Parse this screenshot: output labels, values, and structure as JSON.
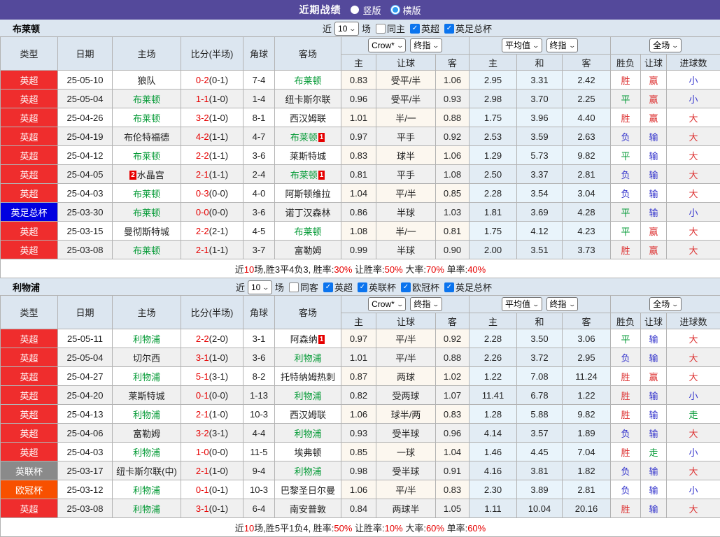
{
  "colors": {
    "accent_bar": "#54499b",
    "header_bg": "#dce6f0",
    "score_red": "#e60000",
    "team_green": "#009933",
    "result_red": "#dd3333",
    "result_green": "#009933",
    "result_blue": "#3333cc",
    "league": {
      "英超": "#ef2d2d",
      "英足总杯": "#0000e0",
      "英联杯": "#8a8a8a",
      "欧冠杯": "#f85000"
    }
  },
  "title_bar": {
    "title": "近期战绩",
    "radios": [
      {
        "label": "竖版",
        "selected": true
      },
      {
        "label": "横版",
        "selected": false
      }
    ]
  },
  "table_header": {
    "static_cols": [
      "类型",
      "日期",
      "主场",
      "比分(半场)",
      "角球",
      "客场"
    ],
    "group1_selects": [
      "Crow*",
      "终指"
    ],
    "group2_selects": [
      "平均值",
      "终指"
    ],
    "group3_selects": [
      "全场"
    ],
    "sub_cols": [
      "主",
      "让球",
      "客",
      "主",
      "和",
      "客",
      "胜负",
      "让球",
      "进球数"
    ]
  },
  "sections": [
    {
      "team": "布莱顿",
      "filter": {
        "near": "近",
        "count": "10",
        "unit": "场",
        "same": {
          "label": "同主",
          "checked": false
        },
        "leagues": [
          {
            "label": "英超",
            "checked": true
          },
          {
            "label": "英足总杯",
            "checked": true
          }
        ]
      },
      "rows": [
        {
          "lg": "英超",
          "date": "25-05-10",
          "home": "狼队",
          "hg": false,
          "hb": "",
          "score": "0-2",
          "half": "(0-1)",
          "corner": "7-4",
          "away": "布莱顿",
          "ag": true,
          "ab": "",
          "o1": "0.83",
          "hd": "受平/半",
          "o2": "1.06",
          "a1": "2.95",
          "a2": "3.31",
          "a3": "2.42",
          "r1": "胜",
          "c1": "r",
          "r2": "赢",
          "c2": "r",
          "r3": "小",
          "c3": "b"
        },
        {
          "lg": "英超",
          "date": "25-05-04",
          "home": "布莱顿",
          "hg": true,
          "hb": "",
          "score": "1-1",
          "half": "(1-0)",
          "corner": "1-4",
          "away": "纽卡斯尔联",
          "ag": false,
          "ab": "",
          "o1": "0.96",
          "hd": "受平/半",
          "o2": "0.93",
          "a1": "2.98",
          "a2": "3.70",
          "a3": "2.25",
          "r1": "平",
          "c1": "g",
          "r2": "赢",
          "c2": "r",
          "r3": "小",
          "c3": "b"
        },
        {
          "lg": "英超",
          "date": "25-04-26",
          "home": "布莱顿",
          "hg": true,
          "hb": "",
          "score": "3-2",
          "half": "(1-0)",
          "corner": "8-1",
          "away": "西汉姆联",
          "ag": false,
          "ab": "",
          "o1": "1.01",
          "hd": "半/一",
          "o2": "0.88",
          "a1": "1.75",
          "a2": "3.96",
          "a3": "4.40",
          "r1": "胜",
          "c1": "r",
          "r2": "赢",
          "c2": "r",
          "r3": "大",
          "c3": "r"
        },
        {
          "lg": "英超",
          "date": "25-04-19",
          "home": "布伦特福德",
          "hg": false,
          "hb": "",
          "score": "4-2",
          "half": "(1-1)",
          "corner": "4-7",
          "away": "布莱顿",
          "ag": true,
          "ab": "1",
          "o1": "0.97",
          "hd": "平手",
          "o2": "0.92",
          "a1": "2.53",
          "a2": "3.59",
          "a3": "2.63",
          "r1": "负",
          "c1": "b",
          "r2": "输",
          "c2": "b",
          "r3": "大",
          "c3": "r"
        },
        {
          "lg": "英超",
          "date": "25-04-12",
          "home": "布莱顿",
          "hg": true,
          "hb": "",
          "score": "2-2",
          "half": "(1-1)",
          "corner": "3-6",
          "away": "莱斯特城",
          "ag": false,
          "ab": "",
          "o1": "0.83",
          "hd": "球半",
          "o2": "1.06",
          "a1": "1.29",
          "a2": "5.73",
          "a3": "9.82",
          "r1": "平",
          "c1": "g",
          "r2": "输",
          "c2": "b",
          "r3": "大",
          "c3": "r"
        },
        {
          "lg": "英超",
          "date": "25-04-05",
          "home": "水晶宫",
          "hg": false,
          "hb": "2",
          "score": "2-1",
          "half": "(1-1)",
          "corner": "2-4",
          "away": "布莱顿",
          "ag": true,
          "ab": "1",
          "o1": "0.81",
          "hd": "平手",
          "o2": "1.08",
          "a1": "2.50",
          "a2": "3.37",
          "a3": "2.81",
          "r1": "负",
          "c1": "b",
          "r2": "输",
          "c2": "b",
          "r3": "大",
          "c3": "r"
        },
        {
          "lg": "英超",
          "date": "25-04-03",
          "home": "布莱顿",
          "hg": true,
          "hb": "",
          "score": "0-3",
          "half": "(0-0)",
          "corner": "4-0",
          "away": "阿斯顿维拉",
          "ag": false,
          "ab": "",
          "o1": "1.04",
          "hd": "平/半",
          "o2": "0.85",
          "a1": "2.28",
          "a2": "3.54",
          "a3": "3.04",
          "r1": "负",
          "c1": "b",
          "r2": "输",
          "c2": "b",
          "r3": "大",
          "c3": "r"
        },
        {
          "lg": "英足总杯",
          "date": "25-03-30",
          "home": "布莱顿",
          "hg": true,
          "hb": "",
          "score": "0-0",
          "half": "(0-0)",
          "corner": "3-6",
          "away": "诺丁汉森林",
          "ag": false,
          "ab": "",
          "o1": "0.86",
          "hd": "半球",
          "o2": "1.03",
          "a1": "1.81",
          "a2": "3.69",
          "a3": "4.28",
          "r1": "平",
          "c1": "g",
          "r2": "输",
          "c2": "b",
          "r3": "小",
          "c3": "b"
        },
        {
          "lg": "英超",
          "date": "25-03-15",
          "home": "曼彻斯特城",
          "hg": false,
          "hb": "",
          "score": "2-2",
          "half": "(2-1)",
          "corner": "4-5",
          "away": "布莱顿",
          "ag": true,
          "ab": "",
          "o1": "1.08",
          "hd": "半/一",
          "o2": "0.81",
          "a1": "1.75",
          "a2": "4.12",
          "a3": "4.23",
          "r1": "平",
          "c1": "g",
          "r2": "赢",
          "c2": "r",
          "r3": "大",
          "c3": "r"
        },
        {
          "lg": "英超",
          "date": "25-03-08",
          "home": "布莱顿",
          "hg": true,
          "hb": "",
          "score": "2-1",
          "half": "(1-1)",
          "corner": "3-7",
          "away": "富勒姆",
          "ag": false,
          "ab": "",
          "o1": "0.99",
          "hd": "半球",
          "o2": "0.90",
          "a1": "2.00",
          "a2": "3.51",
          "a3": "3.73",
          "r1": "胜",
          "c1": "r",
          "r2": "赢",
          "c2": "r",
          "r3": "大",
          "c3": "r"
        }
      ],
      "summary": [
        {
          "t": "近"
        },
        {
          "t": "10",
          "red": true
        },
        {
          "t": "场,胜3平4负3, 胜率:"
        },
        {
          "t": "30%",
          "red": true
        },
        {
          "t": " 让胜率:"
        },
        {
          "t": "50%",
          "red": true
        },
        {
          "t": " 大率:"
        },
        {
          "t": "70%",
          "red": true
        },
        {
          "t": " 单率:"
        },
        {
          "t": "40%",
          "red": true
        }
      ]
    },
    {
      "team": "利物浦",
      "filter": {
        "near": "近",
        "count": "10",
        "unit": "场",
        "same": {
          "label": "同客",
          "checked": false
        },
        "leagues": [
          {
            "label": "英超",
            "checked": true
          },
          {
            "label": "英联杯",
            "checked": true
          },
          {
            "label": "欧冠杯",
            "checked": true
          },
          {
            "label": "英足总杯",
            "checked": true
          }
        ]
      },
      "rows": [
        {
          "lg": "英超",
          "date": "25-05-11",
          "home": "利物浦",
          "hg": true,
          "hb": "",
          "score": "2-2",
          "half": "(2-0)",
          "corner": "3-1",
          "away": "阿森纳",
          "ag": false,
          "ab": "1",
          "o1": "0.97",
          "hd": "平/半",
          "o2": "0.92",
          "a1": "2.28",
          "a2": "3.50",
          "a3": "3.06",
          "r1": "平",
          "c1": "g",
          "r2": "输",
          "c2": "b",
          "r3": "大",
          "c3": "r"
        },
        {
          "lg": "英超",
          "date": "25-05-04",
          "home": "切尔西",
          "hg": false,
          "hb": "",
          "score": "3-1",
          "half": "(1-0)",
          "corner": "3-6",
          "away": "利物浦",
          "ag": true,
          "ab": "",
          "o1": "1.01",
          "hd": "平/半",
          "o2": "0.88",
          "a1": "2.26",
          "a2": "3.72",
          "a3": "2.95",
          "r1": "负",
          "c1": "b",
          "r2": "输",
          "c2": "b",
          "r3": "大",
          "c3": "r"
        },
        {
          "lg": "英超",
          "date": "25-04-27",
          "home": "利物浦",
          "hg": true,
          "hb": "",
          "score": "5-1",
          "half": "(3-1)",
          "corner": "8-2",
          "away": "托特纳姆热刺",
          "ag": false,
          "ab": "",
          "o1": "0.87",
          "hd": "两球",
          "o2": "1.02",
          "a1": "1.22",
          "a2": "7.08",
          "a3": "11.24",
          "r1": "胜",
          "c1": "r",
          "r2": "赢",
          "c2": "r",
          "r3": "大",
          "c3": "r"
        },
        {
          "lg": "英超",
          "date": "25-04-20",
          "home": "莱斯特城",
          "hg": false,
          "hb": "",
          "score": "0-1",
          "half": "(0-0)",
          "corner": "1-13",
          "away": "利物浦",
          "ag": true,
          "ab": "",
          "o1": "0.82",
          "hd": "受两球",
          "o2": "1.07",
          "a1": "11.41",
          "a2": "6.78",
          "a3": "1.22",
          "r1": "胜",
          "c1": "r",
          "r2": "输",
          "c2": "b",
          "r3": "小",
          "c3": "b"
        },
        {
          "lg": "英超",
          "date": "25-04-13",
          "home": "利物浦",
          "hg": true,
          "hb": "",
          "score": "2-1",
          "half": "(1-0)",
          "corner": "10-3",
          "away": "西汉姆联",
          "ag": false,
          "ab": "",
          "o1": "1.06",
          "hd": "球半/两",
          "o2": "0.83",
          "a1": "1.28",
          "a2": "5.88",
          "a3": "9.82",
          "r1": "胜",
          "c1": "r",
          "r2": "输",
          "c2": "b",
          "r3": "走",
          "c3": "g"
        },
        {
          "lg": "英超",
          "date": "25-04-06",
          "home": "富勒姆",
          "hg": false,
          "hb": "",
          "score": "3-2",
          "half": "(3-1)",
          "corner": "4-4",
          "away": "利物浦",
          "ag": true,
          "ab": "",
          "o1": "0.93",
          "hd": "受半球",
          "o2": "0.96",
          "a1": "4.14",
          "a2": "3.57",
          "a3": "1.89",
          "r1": "负",
          "c1": "b",
          "r2": "输",
          "c2": "b",
          "r3": "大",
          "c3": "r"
        },
        {
          "lg": "英超",
          "date": "25-04-03",
          "home": "利物浦",
          "hg": true,
          "hb": "",
          "score": "1-0",
          "half": "(0-0)",
          "corner": "11-5",
          "away": "埃弗顿",
          "ag": false,
          "ab": "",
          "o1": "0.85",
          "hd": "一球",
          "o2": "1.04",
          "a1": "1.46",
          "a2": "4.45",
          "a3": "7.04",
          "r1": "胜",
          "c1": "r",
          "r2": "走",
          "c2": "g",
          "r3": "小",
          "c3": "b"
        },
        {
          "lg": "英联杯",
          "date": "25-03-17",
          "home": "纽卡斯尔联(中)",
          "hg": false,
          "hb": "",
          "score": "2-1",
          "half": "(1-0)",
          "corner": "9-4",
          "away": "利物浦",
          "ag": true,
          "ab": "",
          "o1": "0.98",
          "hd": "受半球",
          "o2": "0.91",
          "a1": "4.16",
          "a2": "3.81",
          "a3": "1.82",
          "r1": "负",
          "c1": "b",
          "r2": "输",
          "c2": "b",
          "r3": "大",
          "c3": "r"
        },
        {
          "lg": "欧冠杯",
          "date": "25-03-12",
          "home": "利物浦",
          "hg": true,
          "hb": "",
          "score": "0-1",
          "half": "(0-1)",
          "corner": "10-3",
          "away": "巴黎圣日尔曼",
          "ag": false,
          "ab": "",
          "o1": "1.06",
          "hd": "平/半",
          "o2": "0.83",
          "a1": "2.30",
          "a2": "3.89",
          "a3": "2.81",
          "r1": "负",
          "c1": "b",
          "r2": "输",
          "c2": "b",
          "r3": "小",
          "c3": "b"
        },
        {
          "lg": "英超",
          "date": "25-03-08",
          "home": "利物浦",
          "hg": true,
          "hb": "",
          "score": "3-1",
          "half": "(0-1)",
          "corner": "6-4",
          "away": "南安普敦",
          "ag": false,
          "ab": "",
          "o1": "0.84",
          "hd": "两球半",
          "o2": "1.05",
          "a1": "1.11",
          "a2": "10.04",
          "a3": "20.16",
          "r1": "胜",
          "c1": "r",
          "r2": "输",
          "c2": "b",
          "r3": "大",
          "c3": "r"
        }
      ],
      "summary": [
        {
          "t": "近"
        },
        {
          "t": "10",
          "red": true
        },
        {
          "t": "场,胜5平1负4, 胜率:"
        },
        {
          "t": "50%",
          "red": true
        },
        {
          "t": " 让胜率:"
        },
        {
          "t": "10%",
          "red": true
        },
        {
          "t": " 大率:"
        },
        {
          "t": "60%",
          "red": true
        },
        {
          "t": " 单率:"
        },
        {
          "t": "60%",
          "red": true
        }
      ]
    }
  ]
}
